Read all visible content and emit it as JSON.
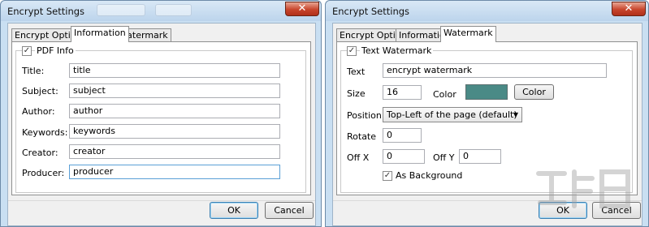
{
  "left_dialog": {
    "title": "Encrypt Settings",
    "close_glyph": "✕",
    "tabs": [
      "Encrypt Options",
      "Information",
      "Watermark"
    ],
    "active_tab": "Information",
    "pdf_info": {
      "label": "PDF Info",
      "checked": true,
      "fields": [
        {
          "label": "Title:",
          "value": "title"
        },
        {
          "label": "Subject:",
          "value": "subject"
        },
        {
          "label": "Author:",
          "value": "author"
        },
        {
          "label": "Keywords:",
          "value": "keywords"
        },
        {
          "label": "Creator:",
          "value": "creator"
        },
        {
          "label": "Producer:",
          "value": "producer"
        }
      ]
    },
    "ok_label": "OK",
    "cancel_label": "Cancel"
  },
  "right_dialog": {
    "title": "Encrypt Settings",
    "close_glyph": "✕",
    "tabs": [
      "Encrypt Options",
      "Information",
      "Watermark"
    ],
    "active_tab": "Watermark",
    "text_watermark": {
      "label": "Text Watermark",
      "checked": true,
      "text_label": "Text",
      "text_value": "encrypt watermark",
      "size_label": "Size",
      "size_value": "16",
      "color_label": "Color",
      "color_value": "#4a8a86",
      "color_button": "Color",
      "position_label": "Position",
      "position_value": "Top-Left of the page (default)",
      "rotate_label": "Rotate",
      "rotate_value": "0",
      "offx_label": "Off X",
      "offx_value": "0",
      "offy_label": "Off Y",
      "offy_value": "0",
      "background_label": "As Background",
      "background_checked": true
    },
    "ok_label": "OK",
    "cancel_label": "Cancel"
  },
  "icons": {
    "check_glyph": "✓",
    "caret_glyph": "▼"
  }
}
